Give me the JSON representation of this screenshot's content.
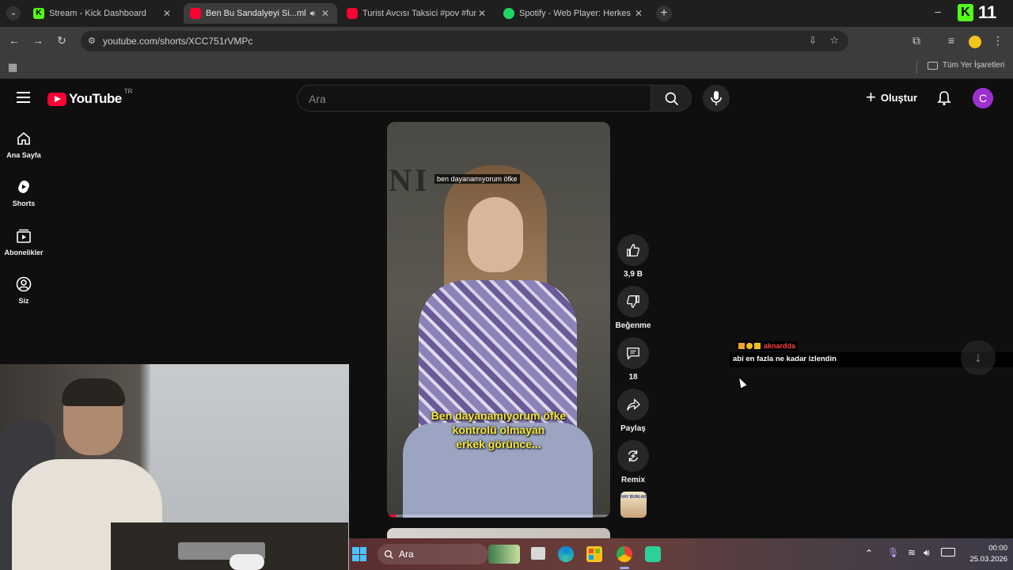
{
  "browser": {
    "tabs": [
      {
        "title": "Stream - Kick Dashboard",
        "active": false,
        "icon": "kick-icon",
        "color": "#53fc18"
      },
      {
        "title": "Ben Bu Sandalyeyi Si...ml #",
        "active": true,
        "icon": "youtube-icon",
        "color": "#ff0033"
      },
      {
        "title": "Turist Avcısı Taksici #pov #funn",
        "active": false,
        "icon": "youtube-icon",
        "color": "#ff0033"
      },
      {
        "title": "Spotify - Web Player: Herkes için",
        "active": false,
        "icon": "spotify-icon",
        "color": "#1ed760"
      }
    ],
    "url": "youtube.com/shorts/XCC751rVMPc",
    "bookmarks_label": "Tüm Yer İşaretleri",
    "overlay_count": "11"
  },
  "youtube": {
    "logo_text": "YouTube",
    "country": "TR",
    "search_placeholder": "Ara",
    "create_label": "Oluştur",
    "avatar_letter": "C",
    "sidebar": [
      {
        "label": "Ana Sayfa",
        "icon": "home-icon"
      },
      {
        "label": "Shorts",
        "icon": "shorts-icon"
      },
      {
        "label": "Abonelikler",
        "icon": "subscriptions-icon"
      },
      {
        "label": "Siz",
        "icon": "you-icon"
      }
    ],
    "video": {
      "top_caption": "ben dayanamıyorum öfke",
      "subtitle_lines": [
        "Ben dayanamıyorum öfke",
        "kontrolü olmayan",
        "erkek görünce..."
      ],
      "bg_letters": "NI"
    },
    "actions": {
      "like_count": "3,9 B",
      "dislike_label": "Beğenme",
      "comment_count": "18",
      "share_label": "Paylaş",
      "remix_label": "Remix",
      "sound_thumb_text": "HAY BUNLAR"
    }
  },
  "chat_overlay": {
    "username": "aknardda",
    "message": "abi en fazla ne kadar izlendin",
    "username_color": "#ff4040"
  },
  "taskbar": {
    "search_label": "Ara",
    "time": "00:00",
    "date": "25.03.2026"
  }
}
